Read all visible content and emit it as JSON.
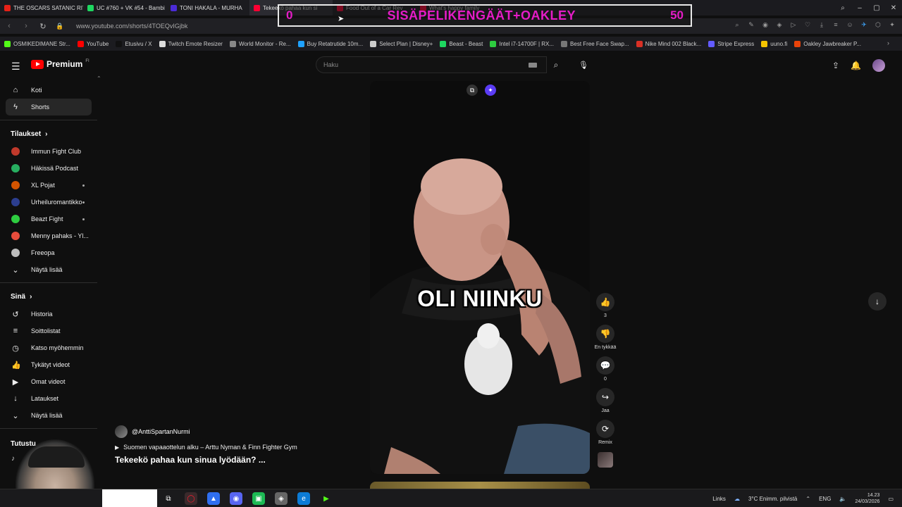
{
  "browser": {
    "tabs": [
      {
        "label": "THE OSCARS SATANIC RITI",
        "color": "#e62117"
      },
      {
        "label": "UC #760 + VK #54 - Bambi",
        "color": "#1ed760"
      },
      {
        "label": "TONI HAKALA - MURHA",
        "color": "#4b2bd6"
      },
      {
        "label": "Tekeekö pahaa kun si",
        "color": "#ff0033",
        "active": true
      },
      {
        "label": "Food Out of a Car Rev",
        "color": "#ff0033"
      },
      {
        "label": "What's happy family",
        "color": "#ff0033"
      }
    ],
    "url": "www.youtube.com/shorts/4TOEQvIGjbk",
    "bookmarks": [
      {
        "label": "OSMIKEDIMANE Str...",
        "color": "#53fc18"
      },
      {
        "label": "YouTube",
        "color": "#ff0000"
      },
      {
        "label": "Etusivu / X",
        "color": "#111111"
      },
      {
        "label": "Twitch Emote Resizer",
        "color": "#dddddd"
      },
      {
        "label": "World Monitor - Re...",
        "color": "#888888"
      },
      {
        "label": "Buy Retatrutide 10m...",
        "color": "#1fa2ff"
      },
      {
        "label": "Select Plan | Disney+",
        "color": "#cccccc"
      },
      {
        "label": "Beast - Beast",
        "color": "#1ed760"
      },
      {
        "label": "Intel i7-14700F | RX...",
        "color": "#2ecc40"
      },
      {
        "label": "Best Free Face Swap...",
        "color": "#777777"
      },
      {
        "label": "Nike Mind 002 Black...",
        "color": "#d93025"
      },
      {
        "label": "Stripe Express",
        "color": "#635bff"
      },
      {
        "label": "uuno.fi",
        "color": "#f5c400"
      },
      {
        "label": "Oakley Jawbreaker P...",
        "color": "#e8430a"
      }
    ]
  },
  "overlay": {
    "left_number": "0",
    "text": "SISÄPELIKENGÄÄT+OAKLEY",
    "right_number": "50"
  },
  "header": {
    "brand": "Premium",
    "country": "FI",
    "search_placeholder": "Haku"
  },
  "sidebar": {
    "main": [
      {
        "label": "Koti",
        "icon": "home-icon",
        "glyph": "⌂"
      },
      {
        "label": "Shorts",
        "icon": "shorts-icon",
        "glyph": "ϟ",
        "active": true
      }
    ],
    "subs_heading": "Tilaukset",
    "subs": [
      {
        "label": "Immun Fight Club",
        "color": "#c0392b"
      },
      {
        "label": "Häkissä Podcast",
        "color": "#27ae60"
      },
      {
        "label": "XL Pojat",
        "color": "#d35400",
        "dot": true
      },
      {
        "label": "Urheiluromantikko",
        "color": "#2c3e8f",
        "dot": true
      },
      {
        "label": "Beazt Fight",
        "color": "#2ecc40",
        "dot": true
      },
      {
        "label": "Menny pahaks - Yl...",
        "color": "#e74c3c"
      },
      {
        "label": "Freeopa",
        "color": "#bdbdbd"
      }
    ],
    "subs_more": "Näytä lisää",
    "you_heading": "Sinä",
    "you": [
      {
        "label": "Historia",
        "icon": "history-icon",
        "glyph": "↺"
      },
      {
        "label": "Soittolistat",
        "icon": "playlists-icon",
        "glyph": "≡"
      },
      {
        "label": "Katso myöhemmin",
        "icon": "watch-later-icon",
        "glyph": "◷"
      },
      {
        "label": "Tykätyt videot",
        "icon": "like-icon",
        "glyph": "👍"
      },
      {
        "label": "Omat videot",
        "icon": "my-videos-icon",
        "glyph": "▶"
      },
      {
        "label": "Lataukset",
        "icon": "download-icon",
        "glyph": "↓"
      }
    ],
    "you_more": "Näytä lisää",
    "explore_heading": "Tutustu"
  },
  "short": {
    "caption": "OLI NIINKU",
    "channel": "@AnttiSpartanNurmi",
    "music": "Suomen vapaaottelun alku – Arttu Nyman & Finn Fighter Gym",
    "title": "Tekeekö pahaa kun sinua lyödään? ...",
    "actions": [
      {
        "name": "like-button",
        "glyph": "👍",
        "label": "3"
      },
      {
        "name": "dislike-button",
        "glyph": "👎",
        "label": "En tykkää"
      },
      {
        "name": "comments-button",
        "glyph": "💬",
        "label": "0"
      },
      {
        "name": "share-button",
        "glyph": "↪",
        "label": "Jaa"
      },
      {
        "name": "remix-button",
        "glyph": "⟳",
        "label": "Remix"
      }
    ]
  },
  "taskbar": {
    "links": "Links",
    "weather": "3°C  Enimm. pilvistä",
    "lang": "ENG",
    "time": "14.23",
    "date": "24/03/2026"
  }
}
